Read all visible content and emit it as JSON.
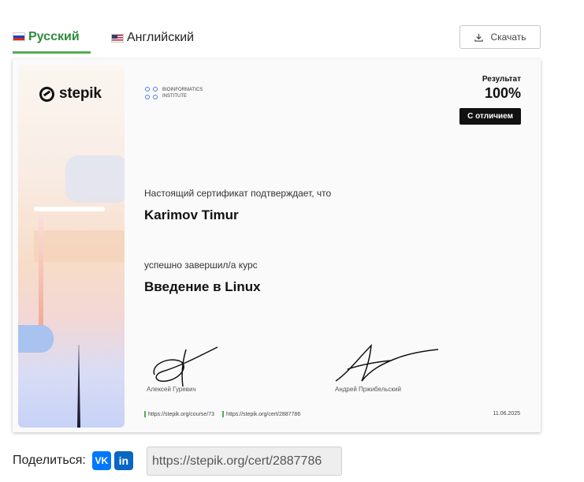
{
  "tabs": [
    {
      "label": "Русский",
      "active": true,
      "flag": "ru-flag-icon"
    },
    {
      "label": "Английский",
      "active": false,
      "flag": "us-flag-icon"
    }
  ],
  "download": {
    "label": "Скачать",
    "icon": "download-icon"
  },
  "certificate": {
    "brand": "stepik",
    "partner_line1": "BIOINFORMATICS",
    "partner_line2": "INSTITUTE",
    "result_label": "Результат",
    "result_value": "100%",
    "distinction": "С отличием",
    "confirm_text": "Настоящий сертификат подтверждает, что",
    "name": "Karimov Timur",
    "completed_text": "успешно завершил/а  курс",
    "course_title": "Введение в Linux",
    "signer1": "Алексей Гуревич",
    "signer2": "Андрей Пржибельский",
    "course_link": "https://stepik.org/course/73",
    "cert_link": "https://stepik.org/cert/2887786",
    "date": "11.06.2025"
  },
  "share": {
    "label": "Поделиться:",
    "vk_label": "VK",
    "linkedin_label": "in",
    "url": "https://stepik.org/cert/2887786"
  },
  "colors": {
    "accent": "#2e8b3a",
    "tab_underline": "#54ad54",
    "vk": "#0077ff",
    "linkedin": "#0a66c2"
  }
}
